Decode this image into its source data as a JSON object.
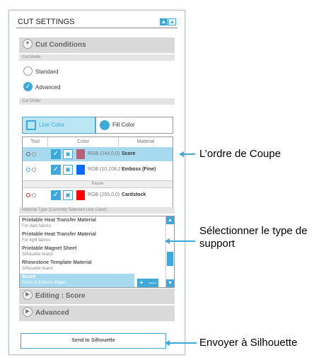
{
  "panel": {
    "title": "CUT SETTINGS",
    "win_btn_up": "▲",
    "win_btn_outline": "▲"
  },
  "sections": {
    "cut_conditions": "Cut Conditions",
    "editing": "Editing : Score",
    "advanced": "Advanced"
  },
  "cut_mode": {
    "label": "Cut Mode",
    "options": [
      {
        "label": "Standard",
        "checked": false
      },
      {
        "label": "Advanced",
        "checked": true
      }
    ]
  },
  "cut_order": {
    "label": "Cut Order",
    "tabs": [
      {
        "label": "Line Color",
        "selected": true
      },
      {
        "label": "Fill Color",
        "selected": false
      }
    ],
    "columns": [
      "Tool",
      "Color",
      "Material"
    ],
    "rows": [
      {
        "color_text": "RGB (244,0,0)",
        "swatch": "#b7627a",
        "material": "Score",
        "selected": true,
        "ring1": "#666666",
        "ring2": "#999999"
      },
      {
        "color_text": "RGB (10,108,255)",
        "swatch": "#0a6cff",
        "material": "Emboss (Fine)",
        "selected": false,
        "ring1": "#3ea8d8",
        "ring2": "#999999"
      },
      {
        "color_text": "RGB (255,0,0)",
        "swatch": "#ff0000",
        "material": "Cardstock",
        "selected": false,
        "ring1": "#e02020",
        "ring2": "#999999"
      }
    ],
    "pause_label": "Pause"
  },
  "material_type": {
    "label": "Material Type (Currently Selected Line Color)",
    "items": [
      {
        "name": "Printable Heat Transfer Material",
        "desc": "For dark fabrics",
        "selected": false
      },
      {
        "name": "Printable Heat Transfer Material",
        "desc": "For light fabrics",
        "selected": false
      },
      {
        "name": "Printable Magnet Sheet",
        "desc": "Silhouette brand",
        "selected": false
      },
      {
        "name": "Rhinestone Template Material",
        "desc": "Silhouette brand",
        "selected": false
      },
      {
        "name": "Score",
        "desc": "Score & Emboss Paper",
        "selected": true
      }
    ],
    "plus": "+",
    "minus": "—"
  },
  "send_button": "Send to Silhouette",
  "callouts": {
    "cut_order": "L’ordre de Coupe",
    "material": "Sélectionner le type de support",
    "send": "Envoyer à Silhouette"
  },
  "accent_color": "#3ea8d8"
}
